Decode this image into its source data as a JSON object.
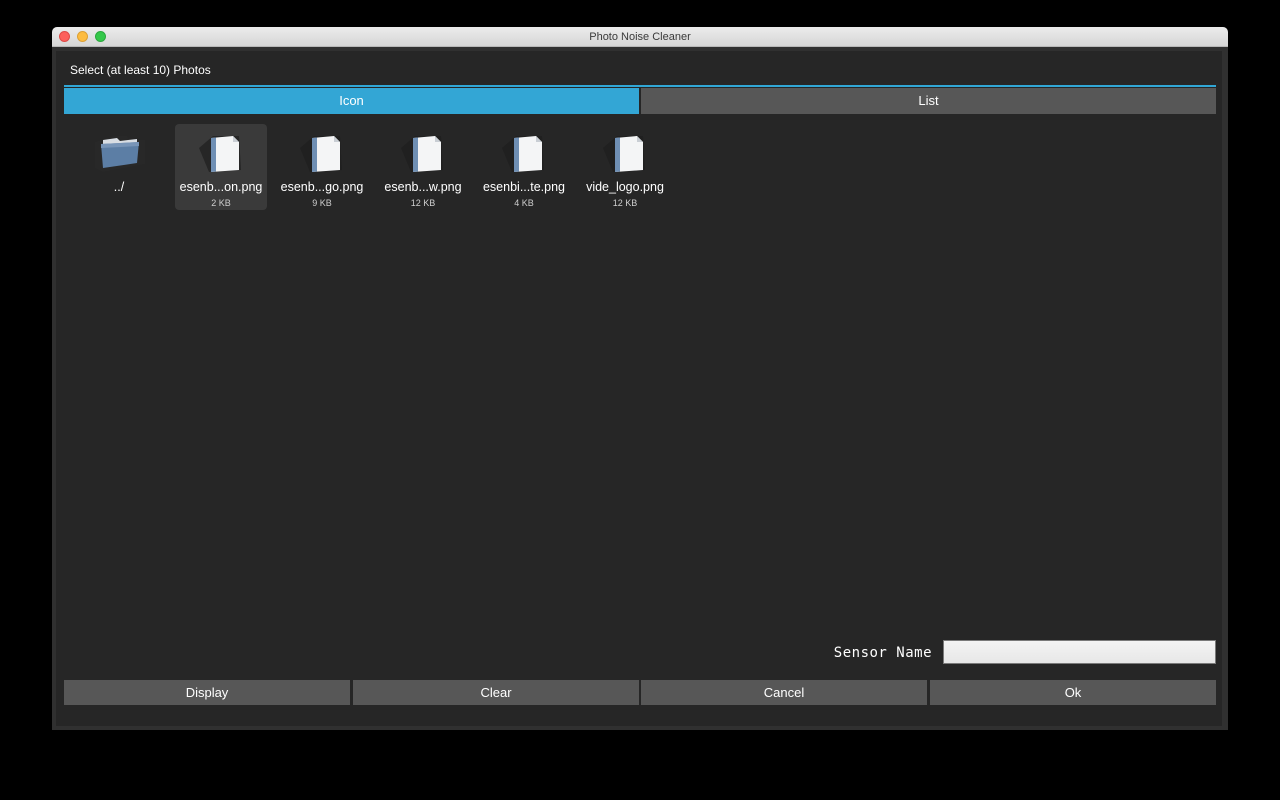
{
  "window": {
    "title": "Photo Noise Cleaner"
  },
  "dialog": {
    "title": "Select (at least 10) Photos",
    "tabs": [
      {
        "label": "Icon",
        "active": true
      },
      {
        "label": "List",
        "active": false
      }
    ]
  },
  "files": [
    {
      "name": "../",
      "size": "",
      "type": "folder"
    },
    {
      "name": "esenb...on.png",
      "size": "2 KB",
      "type": "file",
      "selected": true
    },
    {
      "name": "esenb...go.png",
      "size": "9 KB",
      "type": "file"
    },
    {
      "name": "esenb...w.png",
      "size": "12 KB",
      "type": "file"
    },
    {
      "name": "esenbi...te.png",
      "size": "4 KB",
      "type": "file"
    },
    {
      "name": "vide_logo.png",
      "size": "12 KB",
      "type": "file"
    }
  ],
  "sensor": {
    "label": "Sensor Name",
    "value": "",
    "placeholder": ""
  },
  "buttons": {
    "display": "Display",
    "clear": "Clear",
    "cancel": "Cancel",
    "ok": "Ok"
  },
  "colors": {
    "accent": "#33a6d5",
    "background": "#262626",
    "button": "#575757"
  },
  "icons": {
    "folder": "folder-icon",
    "file": "file-icon"
  }
}
